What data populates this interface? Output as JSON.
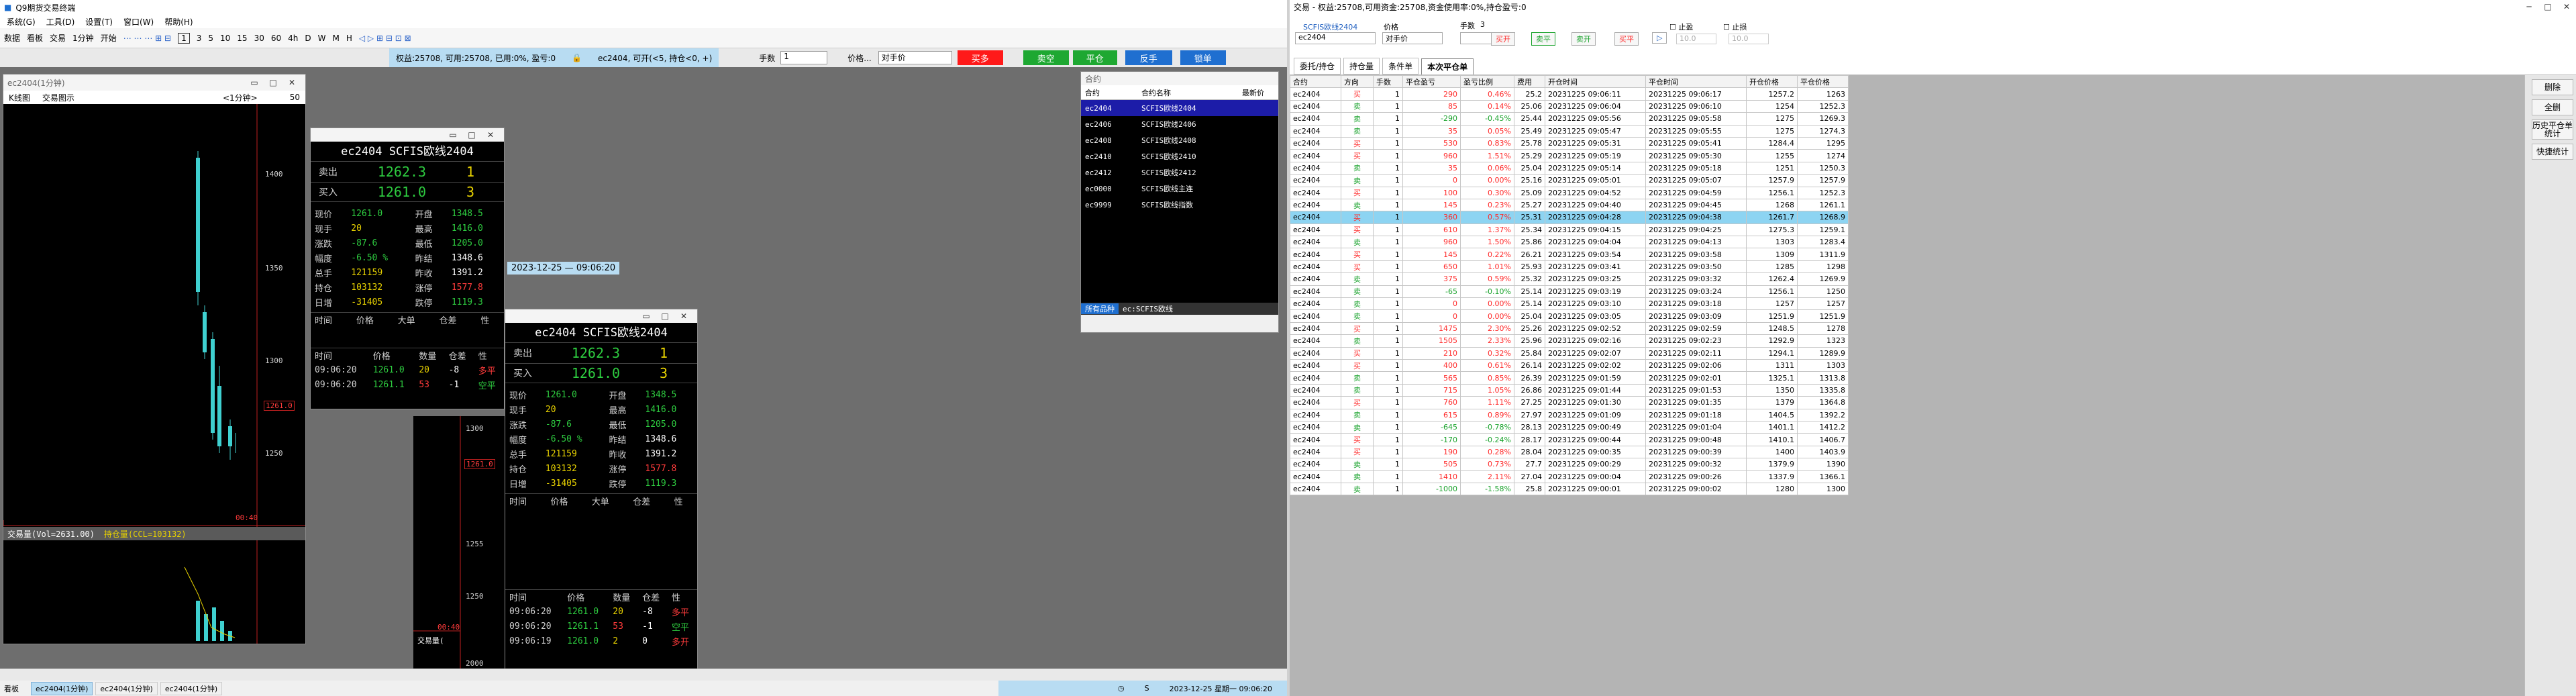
{
  "left": {
    "title": "Q9期货交易终端",
    "menu": [
      "系统(G)",
      "工具(D)",
      "设置(T)",
      "窗口(W)",
      "帮助(H)"
    ],
    "toolbar1": [
      "数据",
      "看板",
      "交易",
      "1分钟",
      "开始"
    ],
    "toolbar2": [
      "1",
      "3",
      "5",
      "10",
      "15",
      "30",
      "60",
      "4h",
      "D",
      "W",
      "M",
      "H"
    ],
    "status_bar": "权益:25708, 可用:25708, 已用:0%, 盈亏:0",
    "order_bar": {
      "contract_hint": "ec2404, 可开(<5, 持仓<0, +)",
      "qty_label": "手数",
      "qty_value": "1",
      "price_label": "价格...",
      "price_value": "对手价",
      "buy_open": "买多",
      "sell_open": "卖空",
      "close": "平仓",
      "reverse": "反手",
      "lock": "锁单"
    },
    "chart_win": {
      "title": "ec2404(1分钟)",
      "tabs": [
        "K线图",
        "交易图示"
      ],
      "period": "<1分钟>",
      "num": "50",
      "y_ticks": [
        "1400",
        "1350",
        "1300",
        "1250"
      ],
      "price_tag": "1261.0",
      "time_tag": "00:40",
      "vol_label": "交易量(Vol=2631.00)",
      "oi_label": "持仓量(CCL=103132)"
    },
    "crosshair_time": "2023-12-25 — 09:06:20",
    "quote1": {
      "title": "ec2404  SCFIS欧线2404",
      "ask_label": "卖出",
      "ask": "1262.3",
      "ask_v": "1",
      "bid_label": "买入",
      "bid": "1261.0",
      "bid_v": "3",
      "fields": [
        [
          "现价",
          "1261.0",
          "开盘",
          "1348.5"
        ],
        [
          "现手",
          "20",
          "最高",
          "1416.0"
        ],
        [
          "涨跌",
          "-87.6",
          "最低",
          "1205.0"
        ],
        [
          "幅度",
          "-6.50 %",
          "昨结",
          "1348.6"
        ],
        [
          "总手",
          "121159",
          "昨收",
          "1391.2"
        ],
        [
          "持仓",
          "103132",
          "涨停",
          "1577.8"
        ],
        [
          "日增",
          "-31405",
          "跌停",
          "1119.3"
        ]
      ],
      "tick_headers": [
        "时间",
        "价格",
        "大单",
        "仓差",
        "性"
      ],
      "tick_headers2": [
        "时间",
        "价格",
        "数量",
        "仓差",
        "性"
      ],
      "ticks": [
        [
          "09:06:20",
          "1261.0",
          "20",
          "-8",
          "多平"
        ],
        [
          "09:06:20",
          "1261.1",
          "53",
          "-1",
          "空平"
        ]
      ]
    },
    "quote2": {
      "title": "ec2404  SCFIS欧线2404",
      "ticks": [
        [
          "09:06:20",
          "1261.0",
          "20",
          "-8",
          "多平"
        ],
        [
          "09:06:20",
          "1261.1",
          "53",
          "-1",
          "空平"
        ],
        [
          "09:06:19",
          "1261.0",
          "2",
          "0",
          "多开"
        ]
      ],
      "y_ticks": [
        "1300",
        "1255",
        "1250",
        "1200"
      ],
      "price_tag": "1261.0",
      "time_tag": "00:40",
      "vol_label": "交易量(",
      "vol_tick": "2000"
    },
    "contract_win": {
      "title": "合约",
      "headers": [
        "合约",
        "合约名称",
        "最新价"
      ],
      "rows": [
        [
          "ec2404",
          "SCFIS欧线2404",
          ""
        ],
        [
          "ec2406",
          "SCFIS欧线2406",
          ""
        ],
        [
          "ec2408",
          "SCFIS欧线2408",
          ""
        ],
        [
          "ec2410",
          "SCFIS欧线2410",
          ""
        ],
        [
          "ec2412",
          "SCFIS欧线2412",
          ""
        ],
        [
          "ec0000",
          "SCFIS欧线主连",
          ""
        ],
        [
          "ec9999",
          "SCFIS欧线指数",
          ""
        ]
      ],
      "tabs": [
        "所有品种",
        "ec:SCFIS欧线"
      ]
    },
    "bottom_tabs": [
      "ec2404(1分钟)",
      "ec2404(1分钟)",
      "ec2404(1分钟)"
    ],
    "bottom_left": "看板",
    "bottom_s": "S",
    "bottom_time": "2023-12-25 星期一 09:06:20"
  },
  "right": {
    "title": "交易 - 权益:25708,可用资金:25708,资金使用率:0%,持仓盈亏:0",
    "contract_label": "SCFIS欧线2404",
    "contract": "ec2404",
    "price_label": "价格",
    "price_value": "对手价",
    "qty_label": "手数",
    "qty_value": "3",
    "buttons": [
      "买开",
      "卖平",
      "卖开",
      "买平"
    ],
    "stop_loss": "止盈",
    "take_profit": "止损",
    "stop_val1": "10.0",
    "stop_val2": "10.0",
    "tabs": [
      "委托/持仓",
      "持仓量",
      "条件单",
      "本次平仓单"
    ],
    "headers": [
      "合约",
      "方向",
      "手数",
      "平仓盈亏",
      "盈亏比例",
      "费用",
      "开仓时间",
      "平仓时间",
      "开仓价格",
      "平仓价格"
    ],
    "rows": [
      [
        "ec2404",
        "买",
        "1",
        "290",
        "0.46%",
        "25.2",
        "20231225 09:06:11",
        "20231225 09:06:17",
        "1257.2",
        "1263"
      ],
      [
        "ec2404",
        "卖",
        "1",
        "85",
        "0.14%",
        "25.06",
        "20231225 09:06:04",
        "20231225 09:06:10",
        "1254",
        "1252.3"
      ],
      [
        "ec2404",
        "卖",
        "1",
        "-290",
        "-0.45%",
        "25.44",
        "20231225 09:05:56",
        "20231225 09:05:58",
        "1275",
        "1269.3"
      ],
      [
        "ec2404",
        "卖",
        "1",
        "35",
        "0.05%",
        "25.49",
        "20231225 09:05:47",
        "20231225 09:05:55",
        "1275",
        "1274.3"
      ],
      [
        "ec2404",
        "买",
        "1",
        "530",
        "0.83%",
        "25.78",
        "20231225 09:05:31",
        "20231225 09:05:41",
        "1284.4",
        "1295"
      ],
      [
        "ec2404",
        "买",
        "1",
        "960",
        "1.51%",
        "25.29",
        "20231225 09:05:19",
        "20231225 09:05:30",
        "1255",
        "1274"
      ],
      [
        "ec2404",
        "卖",
        "1",
        "35",
        "0.06%",
        "25.04",
        "20231225 09:05:14",
        "20231225 09:05:18",
        "1251",
        "1250.3"
      ],
      [
        "ec2404",
        "卖",
        "1",
        "0",
        "0.00%",
        "25.16",
        "20231225 09:05:01",
        "20231225 09:05:07",
        "1257.9",
        "1257.9"
      ],
      [
        "ec2404",
        "买",
        "1",
        "100",
        "0.30%",
        "25.09",
        "20231225 09:04:52",
        "20231225 09:04:59",
        "1256.1",
        "1252.3"
      ],
      [
        "ec2404",
        "卖",
        "1",
        "145",
        "0.23%",
        "25.27",
        "20231225 09:04:40",
        "20231225 09:04:45",
        "1268",
        "1261.1"
      ],
      [
        "ec2404",
        "买",
        "1",
        "360",
        "0.57%",
        "25.31",
        "20231225 09:04:28",
        "20231225 09:04:38",
        "1261.7",
        "1268.9"
      ],
      [
        "ec2404",
        "买",
        "1",
        "610",
        "1.37%",
        "25.34",
        "20231225 09:04:15",
        "20231225 09:04:25",
        "1275.3",
        "1259.1"
      ],
      [
        "ec2404",
        "卖",
        "1",
        "960",
        "1.50%",
        "25.86",
        "20231225 09:04:04",
        "20231225 09:04:13",
        "1303",
        "1283.4"
      ],
      [
        "ec2404",
        "买",
        "1",
        "145",
        "0.22%",
        "26.21",
        "20231225 09:03:54",
        "20231225 09:03:58",
        "1309",
        "1311.9"
      ],
      [
        "ec2404",
        "买",
        "1",
        "650",
        "1.01%",
        "25.93",
        "20231225 09:03:41",
        "20231225 09:03:50",
        "1285",
        "1298"
      ],
      [
        "ec2404",
        "卖",
        "1",
        "375",
        "0.59%",
        "25.32",
        "20231225 09:03:25",
        "20231225 09:03:32",
        "1262.4",
        "1269.9"
      ],
      [
        "ec2404",
        "卖",
        "1",
        "-65",
        "-0.10%",
        "25.14",
        "20231225 09:03:19",
        "20231225 09:03:24",
        "1256.1",
        "1250"
      ],
      [
        "ec2404",
        "卖",
        "1",
        "0",
        "0.00%",
        "25.14",
        "20231225 09:03:10",
        "20231225 09:03:18",
        "1257",
        "1257"
      ],
      [
        "ec2404",
        "卖",
        "1",
        "0",
        "0.00%",
        "25.04",
        "20231225 09:03:05",
        "20231225 09:03:09",
        "1251.9",
        "1251.9"
      ],
      [
        "ec2404",
        "买",
        "1",
        "1475",
        "2.30%",
        "25.26",
        "20231225 09:02:52",
        "20231225 09:02:59",
        "1248.5",
        "1278"
      ],
      [
        "ec2404",
        "卖",
        "1",
        "1505",
        "2.33%",
        "25.96",
        "20231225 09:02:16",
        "20231225 09:02:23",
        "1292.9",
        "1323"
      ],
      [
        "ec2404",
        "买",
        "1",
        "210",
        "0.32%",
        "25.84",
        "20231225 09:02:07",
        "20231225 09:02:11",
        "1294.1",
        "1289.9"
      ],
      [
        "ec2404",
        "买",
        "1",
        "400",
        "0.61%",
        "26.14",
        "20231225 09:02:02",
        "20231225 09:02:06",
        "1311",
        "1303"
      ],
      [
        "ec2404",
        "卖",
        "1",
        "565",
        "0.85%",
        "26.39",
        "20231225 09:01:59",
        "20231225 09:02:01",
        "1325.1",
        "1313.8"
      ],
      [
        "ec2404",
        "卖",
        "1",
        "715",
        "1.05%",
        "26.86",
        "20231225 09:01:44",
        "20231225 09:01:53",
        "1350",
        "1335.8"
      ],
      [
        "ec2404",
        "买",
        "1",
        "760",
        "1.11%",
        "27.25",
        "20231225 09:01:30",
        "20231225 09:01:35",
        "1379",
        "1364.8"
      ],
      [
        "ec2404",
        "卖",
        "1",
        "615",
        "0.89%",
        "27.97",
        "20231225 09:01:09",
        "20231225 09:01:18",
        "1404.5",
        "1392.2"
      ],
      [
        "ec2404",
        "卖",
        "1",
        "-645",
        "-0.78%",
        "28.13",
        "20231225 09:00:49",
        "20231225 09:01:04",
        "1401.1",
        "1412.2"
      ],
      [
        "ec2404",
        "买",
        "1",
        "-170",
        "-0.24%",
        "28.17",
        "20231225 09:00:44",
        "20231225 09:00:48",
        "1410.1",
        "1406.7"
      ],
      [
        "ec2404",
        "买",
        "1",
        "190",
        "0.28%",
        "28.04",
        "20231225 09:00:35",
        "20231225 09:00:39",
        "1400",
        "1403.9"
      ],
      [
        "ec2404",
        "卖",
        "1",
        "505",
        "0.73%",
        "27.7",
        "20231225 09:00:29",
        "20231225 09:00:32",
        "1379.9",
        "1390"
      ],
      [
        "ec2404",
        "卖",
        "1",
        "1410",
        "2.11%",
        "27.04",
        "20231225 09:00:04",
        "20231225 09:00:26",
        "1337.9",
        "1366.1"
      ],
      [
        "ec2404",
        "卖",
        "1",
        "-1000",
        "-1.58%",
        "25.8",
        "20231225 09:00:01",
        "20231225 09:00:02",
        "1280",
        "1300"
      ]
    ],
    "side_buttons": [
      "删除",
      "全删",
      "历史平仓单统计",
      "快捷统计"
    ]
  },
  "colors": {
    "buy": "#ff2a2a",
    "sell": "#1aa32c",
    "select": "#8dd4f2",
    "cyan": "#3fd0d0"
  }
}
